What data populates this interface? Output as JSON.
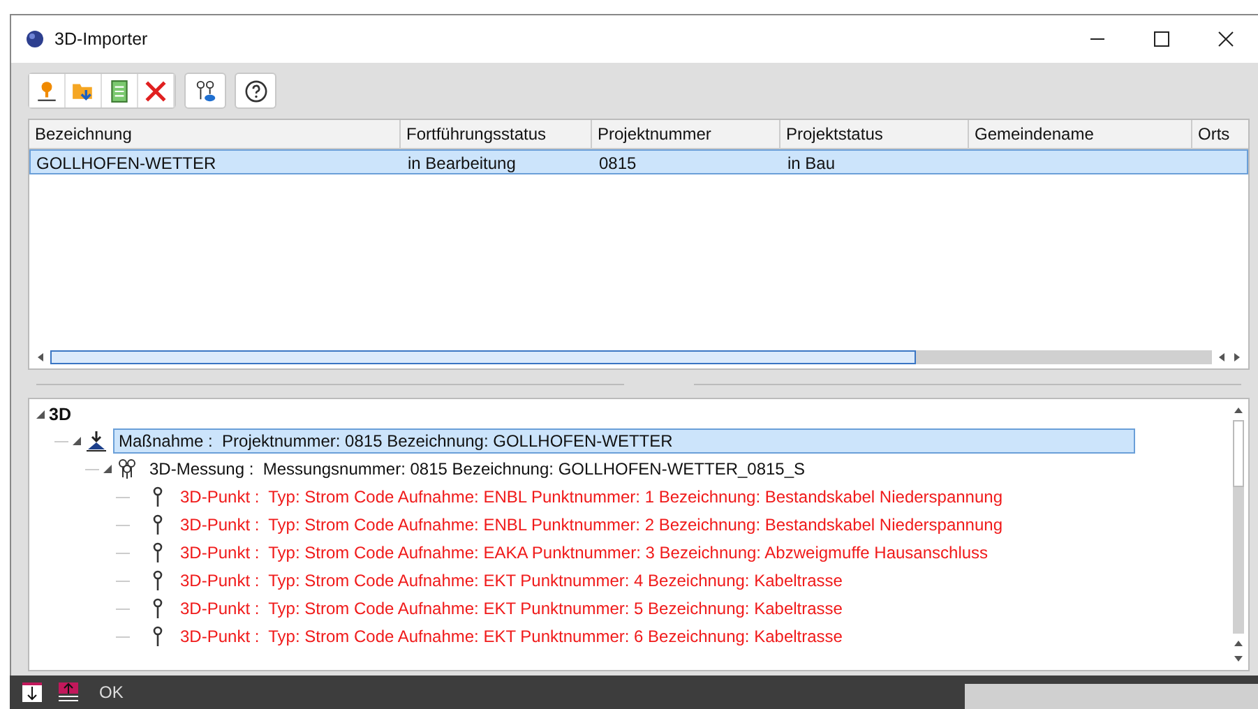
{
  "window": {
    "title": "3D-Importer"
  },
  "toolbar": [
    {
      "kind": "pin"
    },
    {
      "kind": "import"
    },
    {
      "kind": "document"
    },
    {
      "kind": "delete"
    },
    {
      "kind": "measure"
    },
    {
      "kind": "help"
    }
  ],
  "table": {
    "columns": [
      "Bezeichnung",
      "Fortführungsstatus",
      "Projektnummer",
      "Projektstatus",
      "Gemeindename",
      "Orts"
    ],
    "rows": [
      {
        "selected": true,
        "cells": [
          "GOLLHOFEN-WETTER",
          "in Bearbeitung",
          "0815",
          "in Bau",
          "",
          ""
        ]
      }
    ]
  },
  "tree": {
    "label": "3D",
    "expanded": true,
    "children": [
      {
        "kind": "massnahme",
        "selected": true,
        "expanded": true,
        "label": "Maßnahme :",
        "detail": "Projektnummer: 0815 Bezeichnung: GOLLHOFEN-WETTER",
        "children": [
          {
            "kind": "messung",
            "selected": false,
            "expanded": true,
            "label": "3D-Messung :",
            "detail": "Messungsnummer: 0815 Bezeichnung: GOLLHOFEN-WETTER_0815_S",
            "children": [
              {
                "kind": "punkt",
                "selected": false,
                "label": "3D-Punkt :",
                "detail": "Typ: Strom Code Aufnahme: ENBL Punktnummer: 1 Bezeichnung: Bestandskabel Niederspannung"
              },
              {
                "kind": "punkt",
                "selected": false,
                "label": "3D-Punkt :",
                "detail": "Typ: Strom Code Aufnahme: ENBL Punktnummer: 2 Bezeichnung: Bestandskabel Niederspannung"
              },
              {
                "kind": "punkt",
                "selected": false,
                "label": "3D-Punkt :",
                "detail": "Typ: Strom Code Aufnahme: EAKA Punktnummer: 3 Bezeichnung: Abzweigmuffe Hausanschluss"
              },
              {
                "kind": "punkt",
                "selected": false,
                "label": "3D-Punkt :",
                "detail": "Typ: Strom Code Aufnahme: EKT Punktnummer: 4 Bezeichnung: Kabeltrasse"
              },
              {
                "kind": "punkt",
                "selected": false,
                "label": "3D-Punkt :",
                "detail": "Typ: Strom Code Aufnahme: EKT Punktnummer: 5 Bezeichnung: Kabeltrasse"
              },
              {
                "kind": "punkt",
                "selected": false,
                "label": "3D-Punkt :",
                "detail": "Typ: Strom Code Aufnahme: EKT Punktnummer: 6 Bezeichnung: Kabeltrasse"
              }
            ]
          }
        ]
      }
    ]
  },
  "footer": {
    "button": "OK"
  }
}
